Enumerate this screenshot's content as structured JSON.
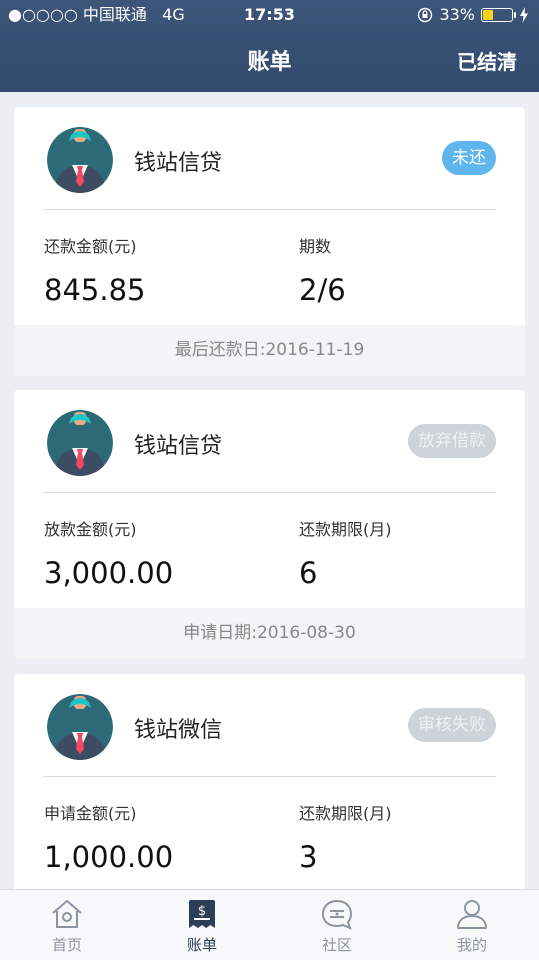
{
  "status_bar": {
    "carrier": "●○○○○ 中国联通",
    "network": "4G",
    "time": "17:53",
    "battery_pct": "33%",
    "battery_level": 0.33,
    "battery_color": "#ffd21a"
  },
  "header": {
    "title": "账单",
    "right_action": "已结清",
    "bg_color": "#3a5275"
  },
  "bills": [
    {
      "lender": "钱站信贷",
      "status": "未还",
      "status_color": "#5fb6ee",
      "fields": [
        {
          "label": "还款金额(元)",
          "value": "845.85"
        },
        {
          "label": "期数",
          "value": "2/6"
        }
      ],
      "footer": "最后还款日:2016-11-19"
    },
    {
      "lender": "钱站信贷",
      "status": "放弃借款",
      "status_color": "#cdd3d9",
      "fields": [
        {
          "label": "放款金额(元)",
          "value": "3,000.00"
        },
        {
          "label": "还款期限(月)",
          "value": "6"
        }
      ],
      "footer": "申请日期:2016-08-30"
    },
    {
      "lender": "钱站微信",
      "status": "审核失败",
      "status_color": "#cdd3d9",
      "fields": [
        {
          "label": "申请金额(元)",
          "value": "1,000.00"
        },
        {
          "label": "还款期限(月)",
          "value": "3"
        }
      ],
      "footer": ""
    }
  ],
  "tabs": [
    {
      "label": "首页",
      "icon": "home-icon"
    },
    {
      "label": "账单",
      "icon": "bill-icon",
      "active": true
    },
    {
      "label": "社区",
      "icon": "chat-icon"
    },
    {
      "label": "我的",
      "icon": "user-icon"
    }
  ]
}
